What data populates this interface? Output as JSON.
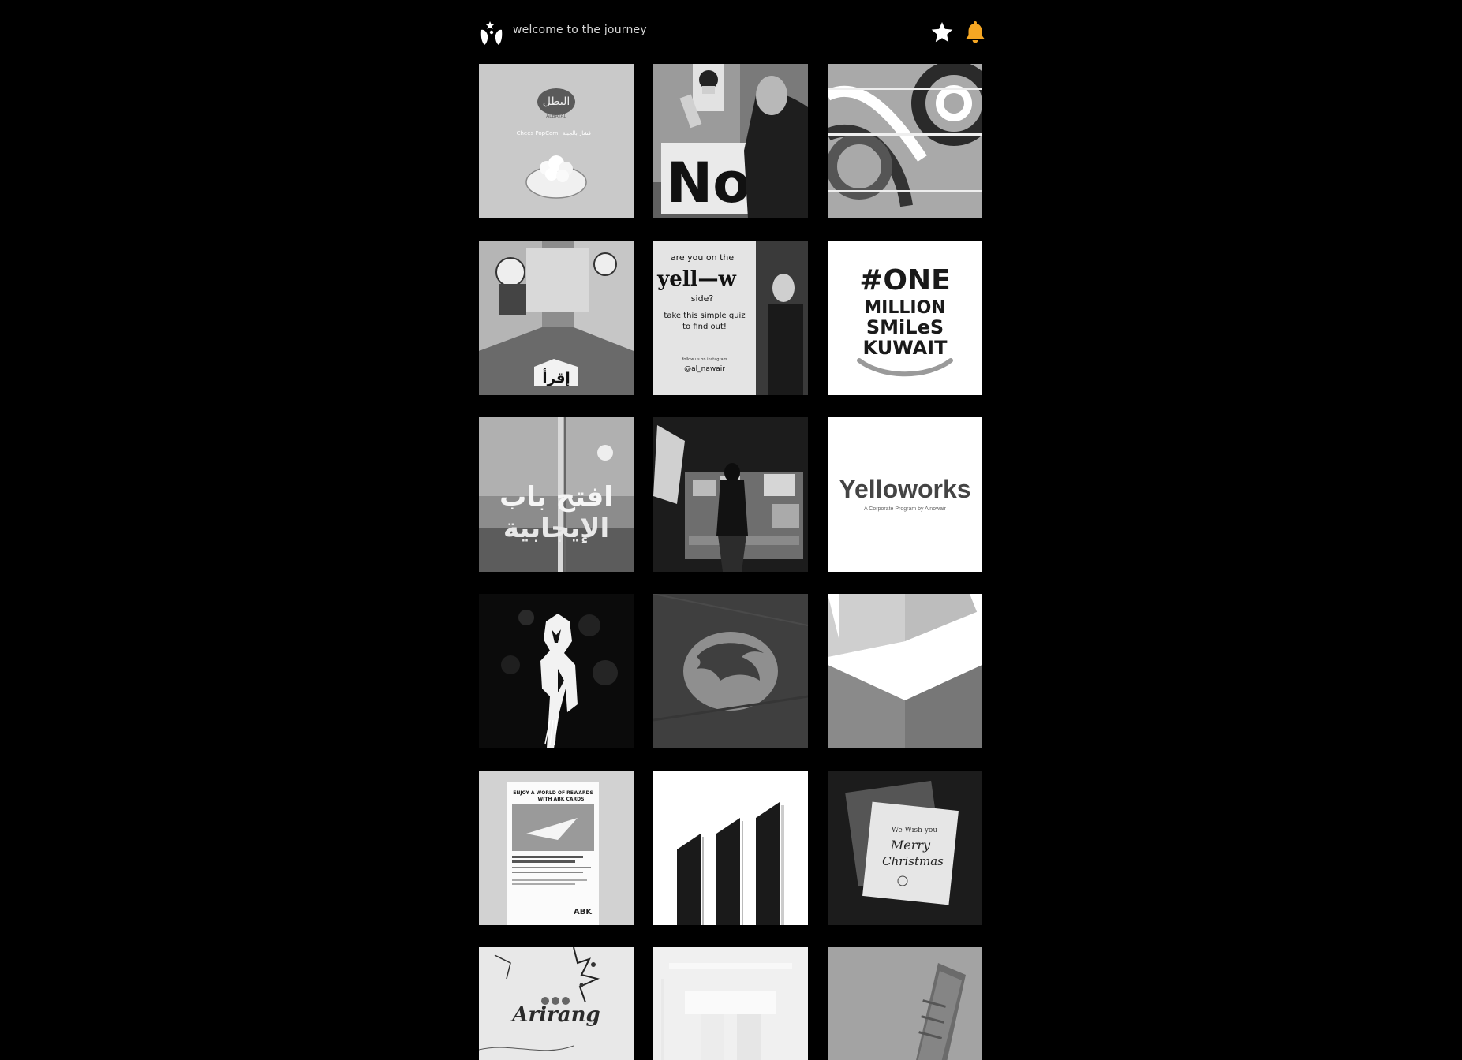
{
  "header": {
    "title": "welcome to the journey",
    "logo_icon": "figure-with-star-logo",
    "favorites_icon": "star-icon",
    "notifications_icon": "bell-icon",
    "notifications_color": "#f5a623"
  },
  "colors": {
    "background": "#000000",
    "title_text": "#d6d6d6",
    "accent_bell": "#f5a623"
  },
  "tiles": [
    {
      "name": "albatal-popcorn",
      "text_a": "البطل",
      "text_b": "ALBATAL",
      "text_c": "Chees PopCorn",
      "text_d": "فشار بالجبنة"
    },
    {
      "name": "bruce-lee-sign",
      "text_a": "No"
    },
    {
      "name": "swirl-pattern"
    },
    {
      "name": "classroom-installation",
      "text_a": "إقرأ"
    },
    {
      "name": "yellow-side-quiz",
      "text_a": "are you on the",
      "text_b": "yell—w",
      "text_c": "side?",
      "text_d": "take this simple quiz",
      "text_e": "to find out!",
      "text_f": "follow us on instagram",
      "text_g": "@al_nawair"
    },
    {
      "name": "one-million-smiles",
      "text_a": "#ONE",
      "text_b": "MILLION",
      "text_c": "SMiLeS",
      "text_d": "KUWAIT"
    },
    {
      "name": "open-door-positivity",
      "text_a": "افتح باب",
      "text_b": "الإيجابية"
    },
    {
      "name": "market-stall-photo"
    },
    {
      "name": "yelloworks-logo",
      "text_a": "Yelloworks",
      "text_b": "A Corporate Program by Alnowair"
    },
    {
      "name": "wolverine-silhouette"
    },
    {
      "name": "thundercats-emblem"
    },
    {
      "name": "geometric-shapes"
    },
    {
      "name": "abk-rewards-poster",
      "text_a": "ENJOY A WORLD OF REWARDS",
      "text_b": "WITH ABK CARDS",
      "text_c": "ABK"
    },
    {
      "name": "black-bars-graphic"
    },
    {
      "name": "merry-christmas-card",
      "text_a": "We Wish you",
      "text_b": "Merry",
      "text_c": "Christmas"
    },
    {
      "name": "arirang-poster",
      "text_a": "Arirang"
    },
    {
      "name": "white-shapes"
    },
    {
      "name": "building-brochure"
    }
  ]
}
